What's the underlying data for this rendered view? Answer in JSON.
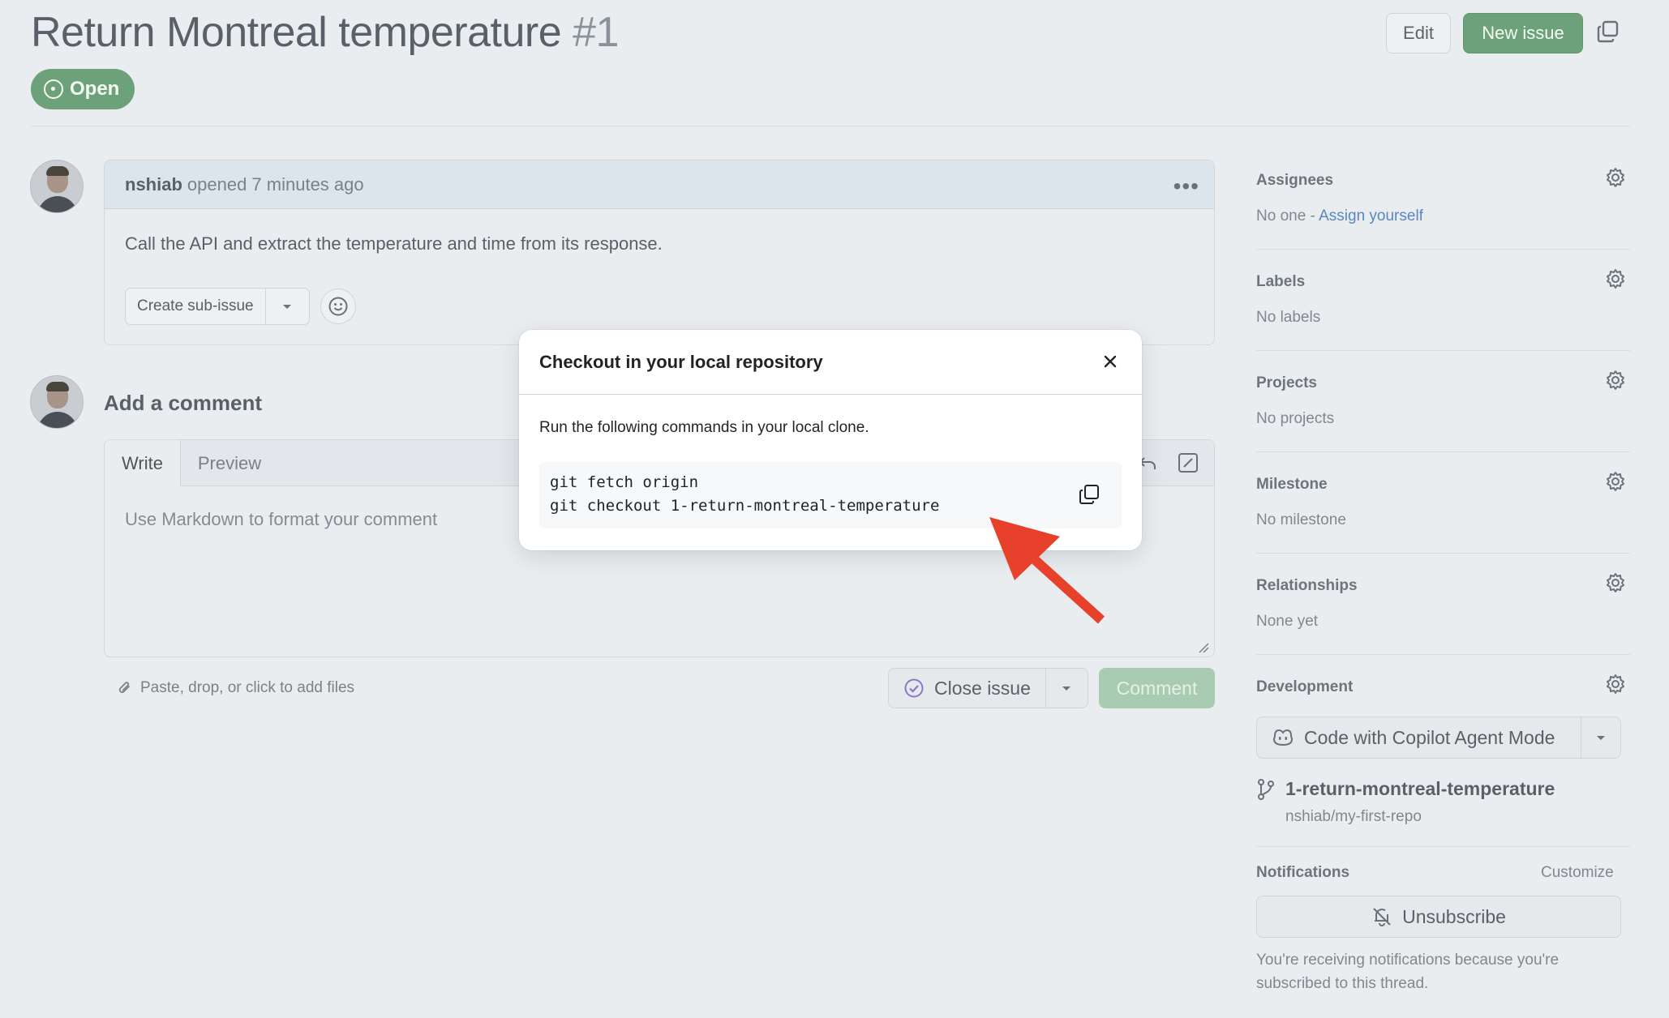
{
  "header": {
    "title": "Return Montreal temperature",
    "number": "#1",
    "edit_label": "Edit",
    "new_issue_label": "New issue",
    "state": "Open"
  },
  "issue": {
    "author": "nshiab",
    "opened_text": "opened 7 minutes ago",
    "body": "Call the API and extract the temperature and time from its response.",
    "sub_issue_label": "Create sub-issue"
  },
  "comment": {
    "heading": "Add a comment",
    "tab_write": "Write",
    "tab_preview": "Preview",
    "placeholder": "Use Markdown to format your comment",
    "attach_text": "Paste, drop, or click to add files",
    "close_issue_label": "Close issue",
    "comment_label": "Comment"
  },
  "sidebar": {
    "assignees": {
      "heading": "Assignees",
      "value": "No one - ",
      "link": "Assign yourself"
    },
    "labels": {
      "heading": "Labels",
      "value": "No labels"
    },
    "projects": {
      "heading": "Projects",
      "value": "No projects"
    },
    "milestone": {
      "heading": "Milestone",
      "value": "No milestone"
    },
    "relationships": {
      "heading": "Relationships",
      "value": "None yet"
    },
    "development": {
      "heading": "Development",
      "copilot_label": "Code with Copilot Agent Mode",
      "branch_name": "1-return-montreal-temperature",
      "branch_repo": "nshiab/my-first-repo"
    },
    "notifications": {
      "heading": "Notifications",
      "customize": "Customize",
      "unsubscribe_label": "Unsubscribe",
      "info": "You're receiving notifications because you're subscribed to this thread."
    }
  },
  "modal": {
    "title": "Checkout in your local repository",
    "description": "Run the following commands in your local clone.",
    "commands": [
      "git fetch origin",
      "git checkout 1-return-montreal-temperature"
    ]
  },
  "colors": {
    "accent_green": "#6da17a",
    "annotation_arrow": "#e8412b",
    "link_blue": "#5b86c2"
  }
}
